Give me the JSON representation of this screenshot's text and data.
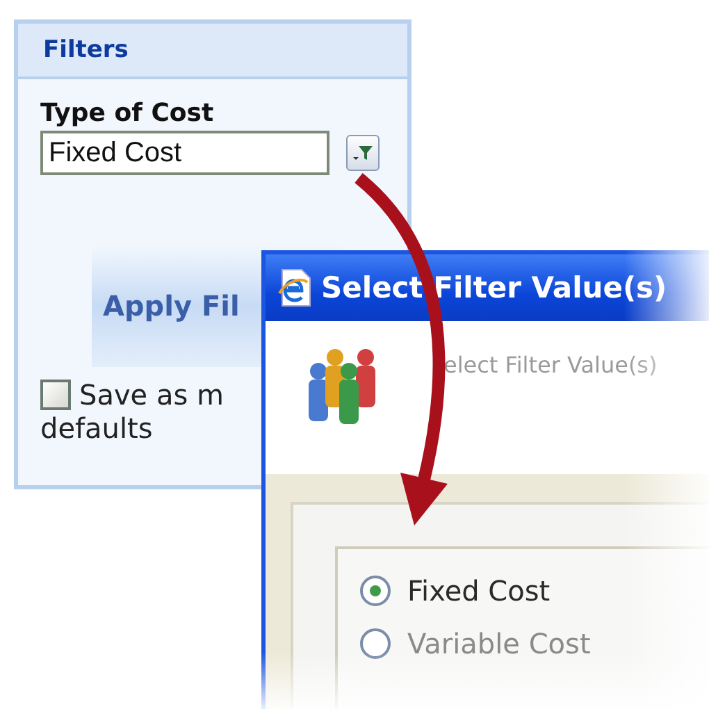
{
  "filters_panel": {
    "title": "Filters",
    "field_label": "Type of Cost",
    "field_value": "Fixed Cost",
    "apply_button": "Apply Fil",
    "save_defaults": {
      "checked": false,
      "label_line_1": "Save as m",
      "label_line_2": "defaults"
    }
  },
  "dialog": {
    "title": "Select Filter Value(s)",
    "heading": "elect Filter Value(s)",
    "options": [
      {
        "label": "Fixed Cost",
        "selected": true
      },
      {
        "label": "Variable Cost",
        "selected": false
      }
    ]
  }
}
